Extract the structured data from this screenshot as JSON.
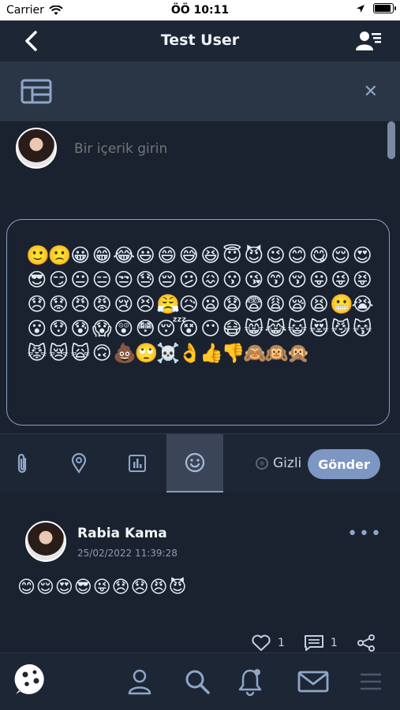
{
  "status": {
    "carrier": "Carrier",
    "time": "ÖÖ 10:11",
    "battery_level": 0.85
  },
  "header": {
    "title": "Test User"
  },
  "compose": {
    "placeholder": "Bir içerik girin",
    "emojis": [
      "🙂",
      "🙁",
      "😀",
      "😁",
      "😂",
      "😃",
      "😄",
      "😅",
      "😆",
      "😇",
      "😈",
      "😉",
      "😊",
      "😋",
      "😌",
      "😍",
      "😎",
      "😏",
      "😐",
      "😑",
      "😒",
      "😓",
      "😔",
      "😕",
      "😖",
      "😗",
      "😘",
      "😙",
      "😚",
      "😛",
      "😜",
      "😝",
      "😞",
      "😟",
      "😠",
      "😡",
      "😢",
      "😣",
      "😤",
      "😥",
      "😦",
      "😧",
      "😨",
      "😩",
      "😪",
      "😫",
      "😬",
      "😭",
      "😮",
      "😯",
      "😰",
      "😱",
      "😲",
      "😳",
      "😴",
      "😵",
      "😶",
      "😷",
      "😸",
      "😹",
      "😺",
      "😻",
      "😼",
      "😽",
      "😾",
      "😿",
      "🙀",
      "🙃",
      "💩",
      "🙄",
      "☠️",
      "👌",
      "👍",
      "👎",
      "🙈",
      "🙉",
      "🙊"
    ]
  },
  "toolbar": {
    "private_label": "Gizli",
    "send_label": "Gönder",
    "active_tab": "emoji"
  },
  "post": {
    "author": "Rabia Kama",
    "date": "25/02/2022 11:39:28",
    "body": "😊😌😍😎😜😞😞😠😈",
    "likes": "1",
    "comments": "1"
  },
  "colors": {
    "accent": "#7d96c2",
    "background": "#1a2230",
    "icon": "#8ea7c9"
  }
}
